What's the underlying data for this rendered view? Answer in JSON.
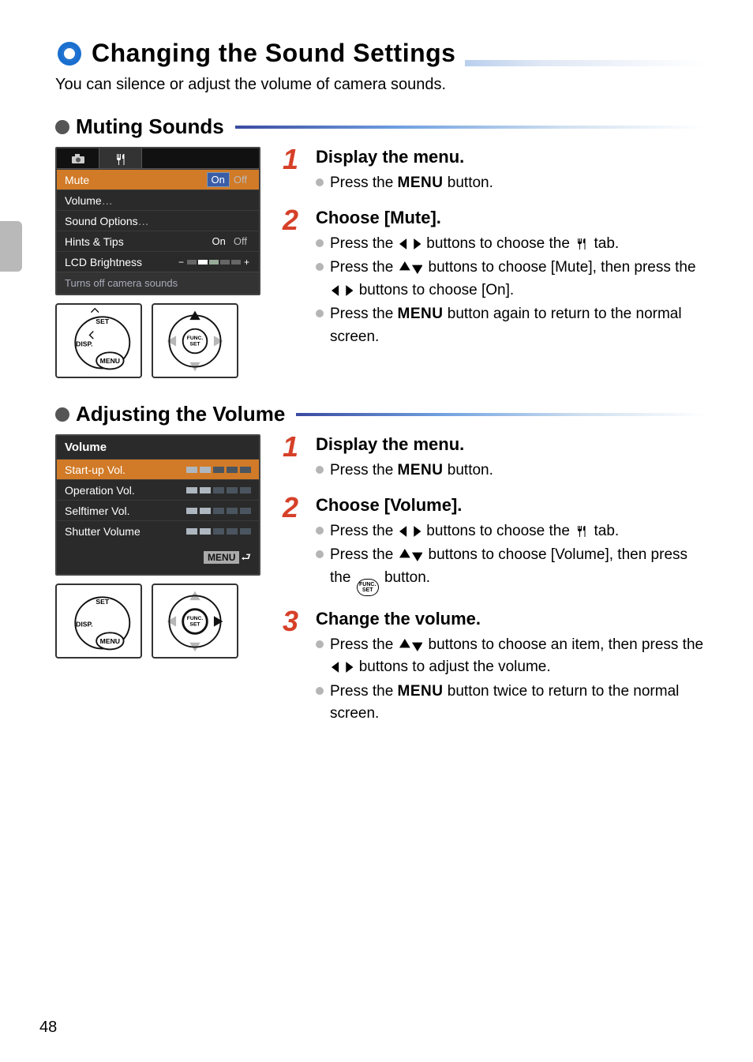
{
  "page_number": "48",
  "page_title": "Changing the Sound Settings",
  "intro": "You can silence or adjust the volume of camera sounds.",
  "section1": {
    "title": "Muting Sounds",
    "lcd": {
      "rows": [
        {
          "label": "Mute",
          "on": "On",
          "off": "Off",
          "hl": true
        },
        {
          "label": "Volume",
          "sub": true
        },
        {
          "label": "Sound Options",
          "sub": true
        },
        {
          "label": "Hints & Tips",
          "on": "On",
          "off": "Off"
        },
        {
          "label": "LCD Brightness",
          "slider": true
        }
      ],
      "hint": "Turns off camera sounds"
    },
    "steps": [
      {
        "n": "1",
        "title": "Display the menu.",
        "bullets": [
          {
            "text_before": "Press the ",
            "icon": "menu",
            "text_after": " button."
          }
        ]
      },
      {
        "n": "2",
        "title": "Choose [Mute].",
        "bullets": [
          {
            "text_before": "Press the ",
            "icon": "lr",
            "text_mid": " buttons to choose the ",
            "icon2": "tools",
            "text_after": " tab."
          },
          {
            "text_before": "Press the ",
            "icon": "ud",
            "text_mid": " buttons to choose [Mute], then press the ",
            "icon2": "lr",
            "text_after": " buttons to choose [On]."
          },
          {
            "text_before": "Press the ",
            "icon": "menu",
            "text_after": " button again to return to the normal screen."
          }
        ]
      }
    ]
  },
  "section2": {
    "title": "Adjusting the Volume",
    "lcd": {
      "title": "Volume",
      "rows": [
        {
          "label": "Start-up Vol.",
          "level": 2,
          "hl": true
        },
        {
          "label": "Operation Vol.",
          "level": 2
        },
        {
          "label": "Selftimer Vol.",
          "level": 2
        },
        {
          "label": "Shutter Volume",
          "level": 2
        }
      ],
      "return_label": "MENU"
    },
    "steps": [
      {
        "n": "1",
        "title": "Display the menu.",
        "bullets": [
          {
            "text_before": "Press the ",
            "icon": "menu",
            "text_after": " button."
          }
        ]
      },
      {
        "n": "2",
        "title": "Choose [Volume].",
        "bullets": [
          {
            "text_before": "Press the ",
            "icon": "lr",
            "text_mid": " buttons to choose the ",
            "icon2": "tools",
            "text_after": " tab."
          },
          {
            "text_before": "Press the ",
            "icon": "ud",
            "text_mid": " buttons to choose [Volume], then press the ",
            "icon2": "funcset",
            "text_after": " button."
          }
        ]
      },
      {
        "n": "3",
        "title": "Change the volume.",
        "bullets": [
          {
            "text_before": "Press the ",
            "icon": "ud",
            "text_mid": " buttons to choose an item, then press the ",
            "icon2": "lr",
            "text_after": " buttons to adjust the volume."
          },
          {
            "text_before": "Press the ",
            "icon": "menu",
            "text_after": " button twice to return to the normal screen."
          }
        ]
      }
    ]
  }
}
